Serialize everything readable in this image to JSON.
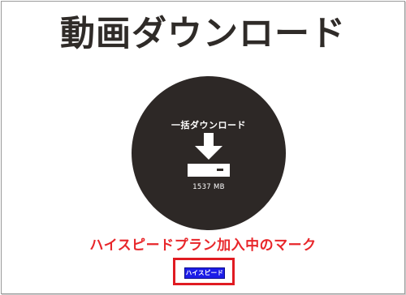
{
  "page": {
    "title": "動画ダウンロード"
  },
  "download": {
    "label": "一括ダウンロード",
    "size": "1537 MB",
    "icon": "download-icon"
  },
  "annotation": {
    "text": "ハイスピードプラン加入中のマーク"
  },
  "badge": {
    "label": "ハイスピード",
    "color": "#1d1de8"
  },
  "colors": {
    "circle": "#2d2826",
    "annotation": "#e8262a",
    "highlight_border": "#e01b22"
  }
}
